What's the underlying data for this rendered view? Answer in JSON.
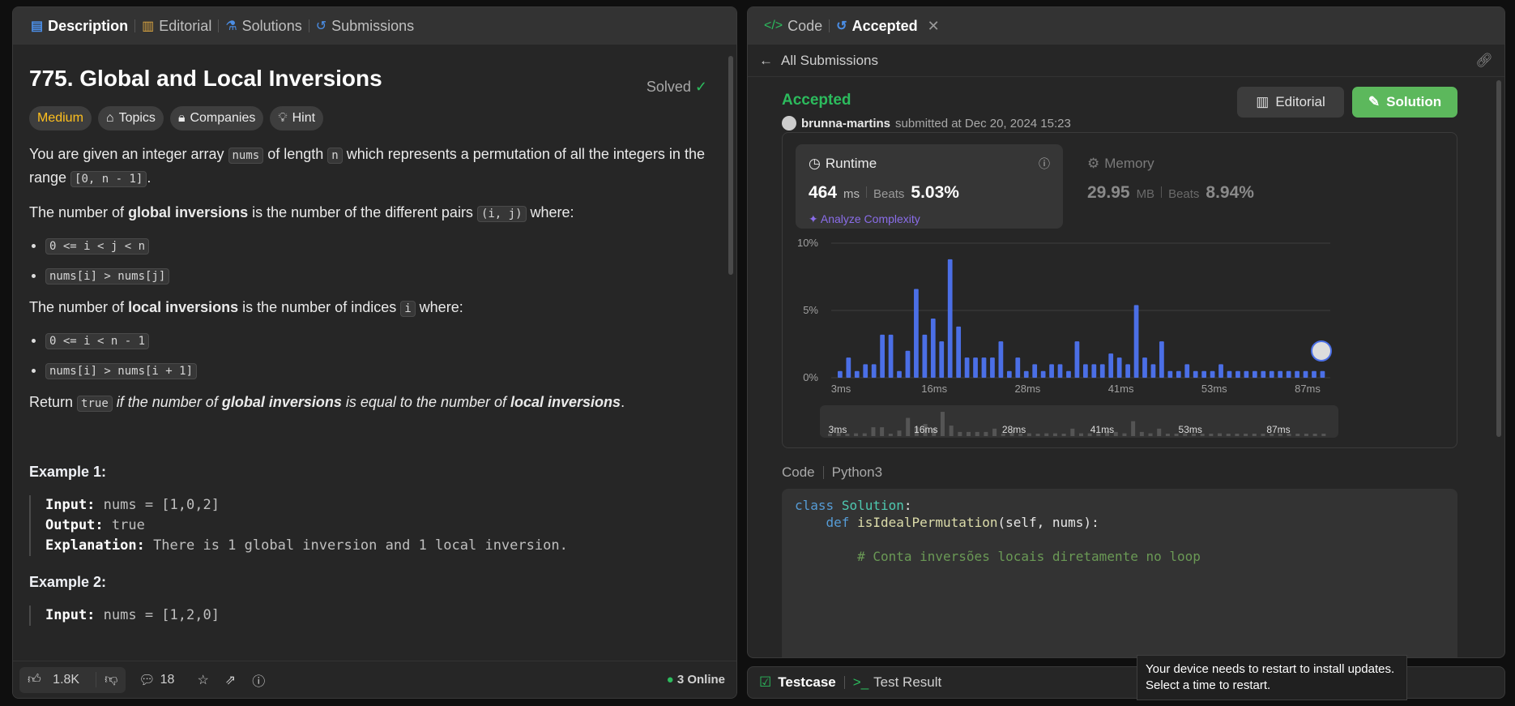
{
  "left_tabs": {
    "description": "Description",
    "editorial": "Editorial",
    "solutions": "Solutions",
    "submissions": "Submissions"
  },
  "problem": {
    "title": "775. Global and Local Inversions",
    "solved": "Solved",
    "difficulty": "Medium",
    "topics": "Topics",
    "companies": "Companies",
    "hint": "Hint",
    "p1_a": "You are given an integer array ",
    "p1_code1": "nums",
    "p1_b": " of length ",
    "p1_code2": "n",
    "p1_c": " which represents a permutation of all the integers in the range ",
    "p1_code3": "[0, n - 1]",
    "p1_d": ".",
    "p2_a": "The number of ",
    "p2_bold": "global inversions",
    "p2_b": " is the number of the different pairs ",
    "p2_code": "(i, j)",
    "p2_c": " where:",
    "g_items": [
      "0 <= i < j < n",
      "nums[i] > nums[j]"
    ],
    "p3_a": "The number of ",
    "p3_bold": "local inversions",
    "p3_b": " is the number of indices ",
    "p3_code": "i",
    "p3_c": " where:",
    "l_items": [
      "0 <= i < n - 1",
      "nums[i] > nums[i + 1]"
    ],
    "p4_a": "Return ",
    "p4_code": "true",
    "p4_b": " if the number of ",
    "p4_bold1": "global inversions",
    "p4_c": " is equal to the number of ",
    "p4_bold2": "local inversions",
    "p4_d": ".",
    "ex1_h": "Example 1:",
    "ex1_input_lbl": "Input:",
    "ex1_input": " nums = [1,0,2]",
    "ex1_output_lbl": "Output:",
    "ex1_output": " true",
    "ex1_expl_lbl": "Explanation:",
    "ex1_expl": " There is 1 global inversion and 1 local inversion.",
    "ex2_h": "Example 2:",
    "ex2_input_lbl": "Input:",
    "ex2_input": " nums = [1,2,0]"
  },
  "footer": {
    "likes": "1.8K",
    "comments": "18",
    "online": "3 Online"
  },
  "right_tabs": {
    "code": "Code",
    "accepted": "Accepted"
  },
  "submission": {
    "back": "All Submissions",
    "status": "Accepted",
    "user": "brunna-martins",
    "submitted_at": "submitted at Dec 20, 2024 15:23",
    "editorial_btn": "Editorial",
    "solution_btn": "Solution",
    "runtime_label": "Runtime",
    "runtime_value": "464",
    "runtime_unit": "ms",
    "beats_label": "Beats",
    "runtime_beats": "5.03%",
    "analyze": "Analyze Complexity",
    "memory_label": "Memory",
    "memory_value": "29.95",
    "memory_unit": "MB",
    "memory_beats": "8.94%",
    "code_label": "Code",
    "language": "Python3"
  },
  "chart_data": {
    "type": "bar",
    "ylabel": "",
    "yticks": [
      "10%",
      "5%",
      "0%"
    ],
    "ylim": [
      0,
      10
    ],
    "xticks": [
      "3ms",
      "16ms",
      "28ms",
      "41ms",
      "53ms",
      "87ms"
    ],
    "bar_color": "#4b6fe6",
    "values": [
      0.5,
      1.5,
      0.5,
      1,
      1,
      3.2,
      3.2,
      0.5,
      2,
      6.6,
      3.2,
      4.4,
      2.7,
      8.8,
      3.8,
      1.5,
      1.5,
      1.5,
      1.5,
      2.7,
      0.5,
      1.5,
      0.5,
      1,
      0.5,
      1,
      1,
      0.5,
      2.7,
      1,
      1,
      1,
      1.8,
      1.5,
      1,
      5.4,
      1.5,
      1,
      2.7,
      0.5,
      0.5,
      1,
      0.5,
      0.5,
      0.5,
      1,
      0.5,
      0.5,
      0.5,
      0.5,
      0.5,
      0.5,
      0.5,
      0.5,
      0.5,
      0.5,
      0.5,
      0.5
    ]
  },
  "bottom": {
    "testcase": "Testcase",
    "test_result": "Test Result"
  },
  "toast": {
    "line1": "Your device needs to restart to install updates.",
    "line2": "Select a time to restart."
  }
}
